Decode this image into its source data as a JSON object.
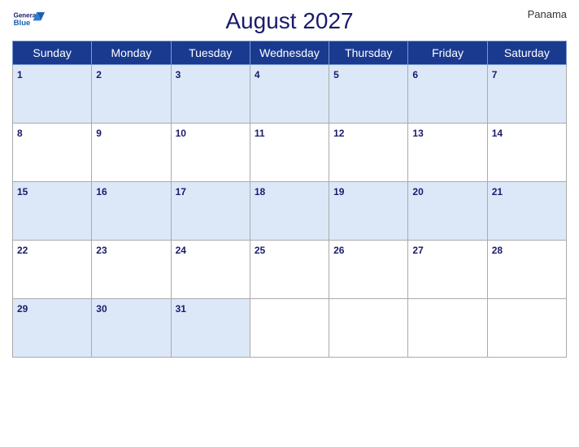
{
  "header": {
    "logo_general": "General",
    "logo_blue": "Blue",
    "month_title": "August 2027",
    "country": "Panama"
  },
  "days_of_week": [
    "Sunday",
    "Monday",
    "Tuesday",
    "Wednesday",
    "Thursday",
    "Friday",
    "Saturday"
  ],
  "weeks": [
    [
      1,
      2,
      3,
      4,
      5,
      6,
      7
    ],
    [
      8,
      9,
      10,
      11,
      12,
      13,
      14
    ],
    [
      15,
      16,
      17,
      18,
      19,
      20,
      21
    ],
    [
      22,
      23,
      24,
      25,
      26,
      27,
      28
    ],
    [
      29,
      30,
      31,
      null,
      null,
      null,
      null
    ]
  ]
}
